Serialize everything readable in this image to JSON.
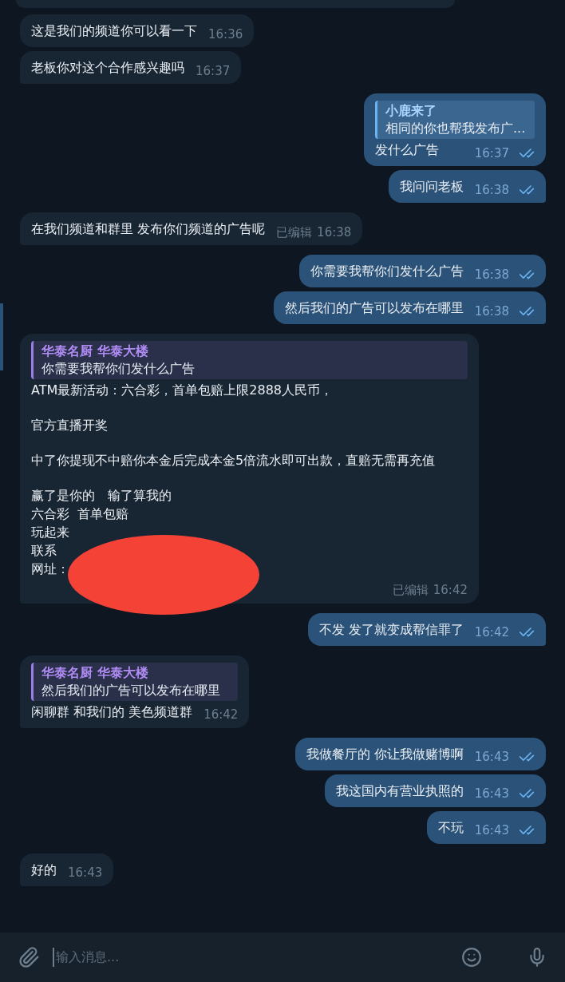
{
  "messages": [
    {
      "kind": "incoming",
      "text": "这是我们的频道你可以看一下",
      "time": "16:36"
    },
    {
      "kind": "incoming",
      "text": "老板你对这个合作感兴趣吗",
      "time": "16:37"
    },
    {
      "kind": "outgoing",
      "reply": {
        "author": "小鹿来了",
        "text": "相同的你也帮我发布广..."
      },
      "text": "发什么广告",
      "time": "16:37",
      "read": true
    },
    {
      "kind": "outgoing",
      "text": "我问问老板",
      "time": "16:38",
      "read": true
    },
    {
      "kind": "incoming",
      "text": "在我们频道和群里 发布你们频道的广告呢",
      "edited": "已编辑",
      "time": "16:38"
    },
    {
      "kind": "outgoing",
      "text": "你需要我帮你们发什么广告",
      "time": "16:38",
      "read": true
    },
    {
      "kind": "outgoing",
      "text": "然后我们的广告可以发布在哪里",
      "time": "16:38",
      "read": true
    },
    {
      "kind": "incoming",
      "reply": {
        "author": "华泰名厨 华泰大楼",
        "text": "你需要我帮你们发什么广告"
      },
      "paragraphs": [
        [
          "ATM最新活动：六合彩，首单包赔上限2888人民币，"
        ],
        [
          "官方直播开奖"
        ],
        [
          "中了你提现不中赔你本金后完成本金5倍流水即可出款，直赔无需再充值"
        ],
        [
          "赢了是你的　输了算我的",
          "六合彩  首单包赔",
          "玩起来",
          "联系",
          "网址："
        ]
      ],
      "edited": "已编辑",
      "time": "16:42",
      "redacted": true
    },
    {
      "kind": "outgoing",
      "text": "不发 发了就变成帮信罪了",
      "time": "16:42",
      "read": true
    },
    {
      "kind": "incoming",
      "reply": {
        "author": "华泰名厨 华泰大楼",
        "text": "然后我们的广告可以发布在哪里"
      },
      "text": "闲聊群 和我们的 美色频道群",
      "time": "16:42"
    },
    {
      "kind": "outgoing",
      "text": "我做餐厅的 你让我做赌博啊",
      "time": "16:43",
      "read": true
    },
    {
      "kind": "outgoing",
      "text": "我这国内有营业执照的",
      "time": "16:43",
      "read": true
    },
    {
      "kind": "outgoing",
      "text": "不玩",
      "time": "16:43",
      "read": true
    },
    {
      "kind": "incoming",
      "text": "好的",
      "time": "16:43"
    }
  ],
  "composer": {
    "placeholder": "输入消息..."
  }
}
